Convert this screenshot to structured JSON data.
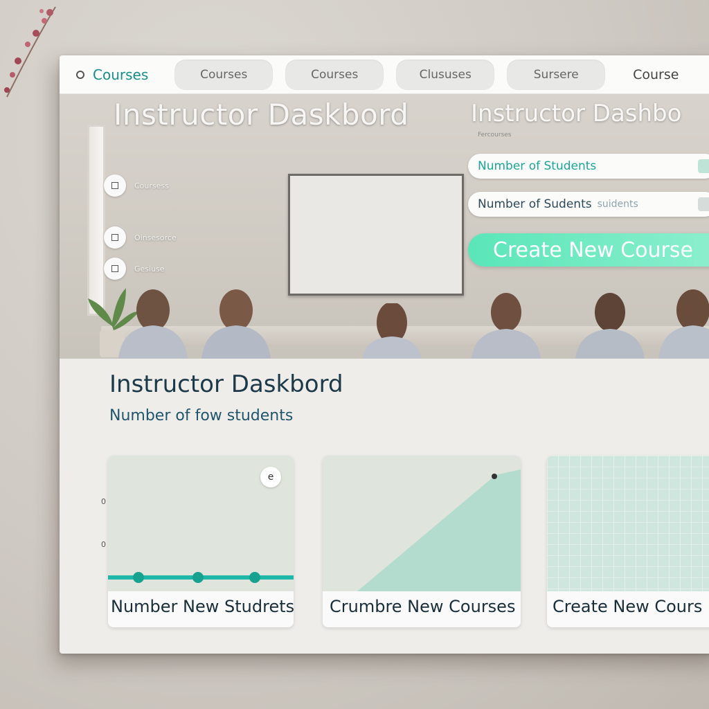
{
  "nav": {
    "brand": "Courses",
    "tabs": [
      "Courses",
      "Courses",
      "Clususes",
      "Sursere"
    ],
    "last_link": "Course"
  },
  "hero": {
    "title": "Instructor Daskbord",
    "side_items": [
      "Coursess",
      "Oinsesorce",
      "Gesiuse"
    ],
    "right_title": "Instructor Dashbo",
    "right_subtitle": "Fercourses",
    "stat1": "Number of Students",
    "stat2_a": "Number of Sudents",
    "stat2_b": "suidents",
    "create_button": "Create New Course"
  },
  "main": {
    "title": "Instructor Daskbord",
    "subtitle": "Number of fow students",
    "tick_a": "0",
    "tick_b": "0",
    "card1_label": "Number New Studrets",
    "card1_badge": "e",
    "card2_label": "Crumbre New Courses",
    "card3_label": "Create New Cours"
  },
  "colors": {
    "accent_teal": "#1fb8a8",
    "button_green": "#5ae6b8",
    "title_dark": "#1b3948"
  }
}
